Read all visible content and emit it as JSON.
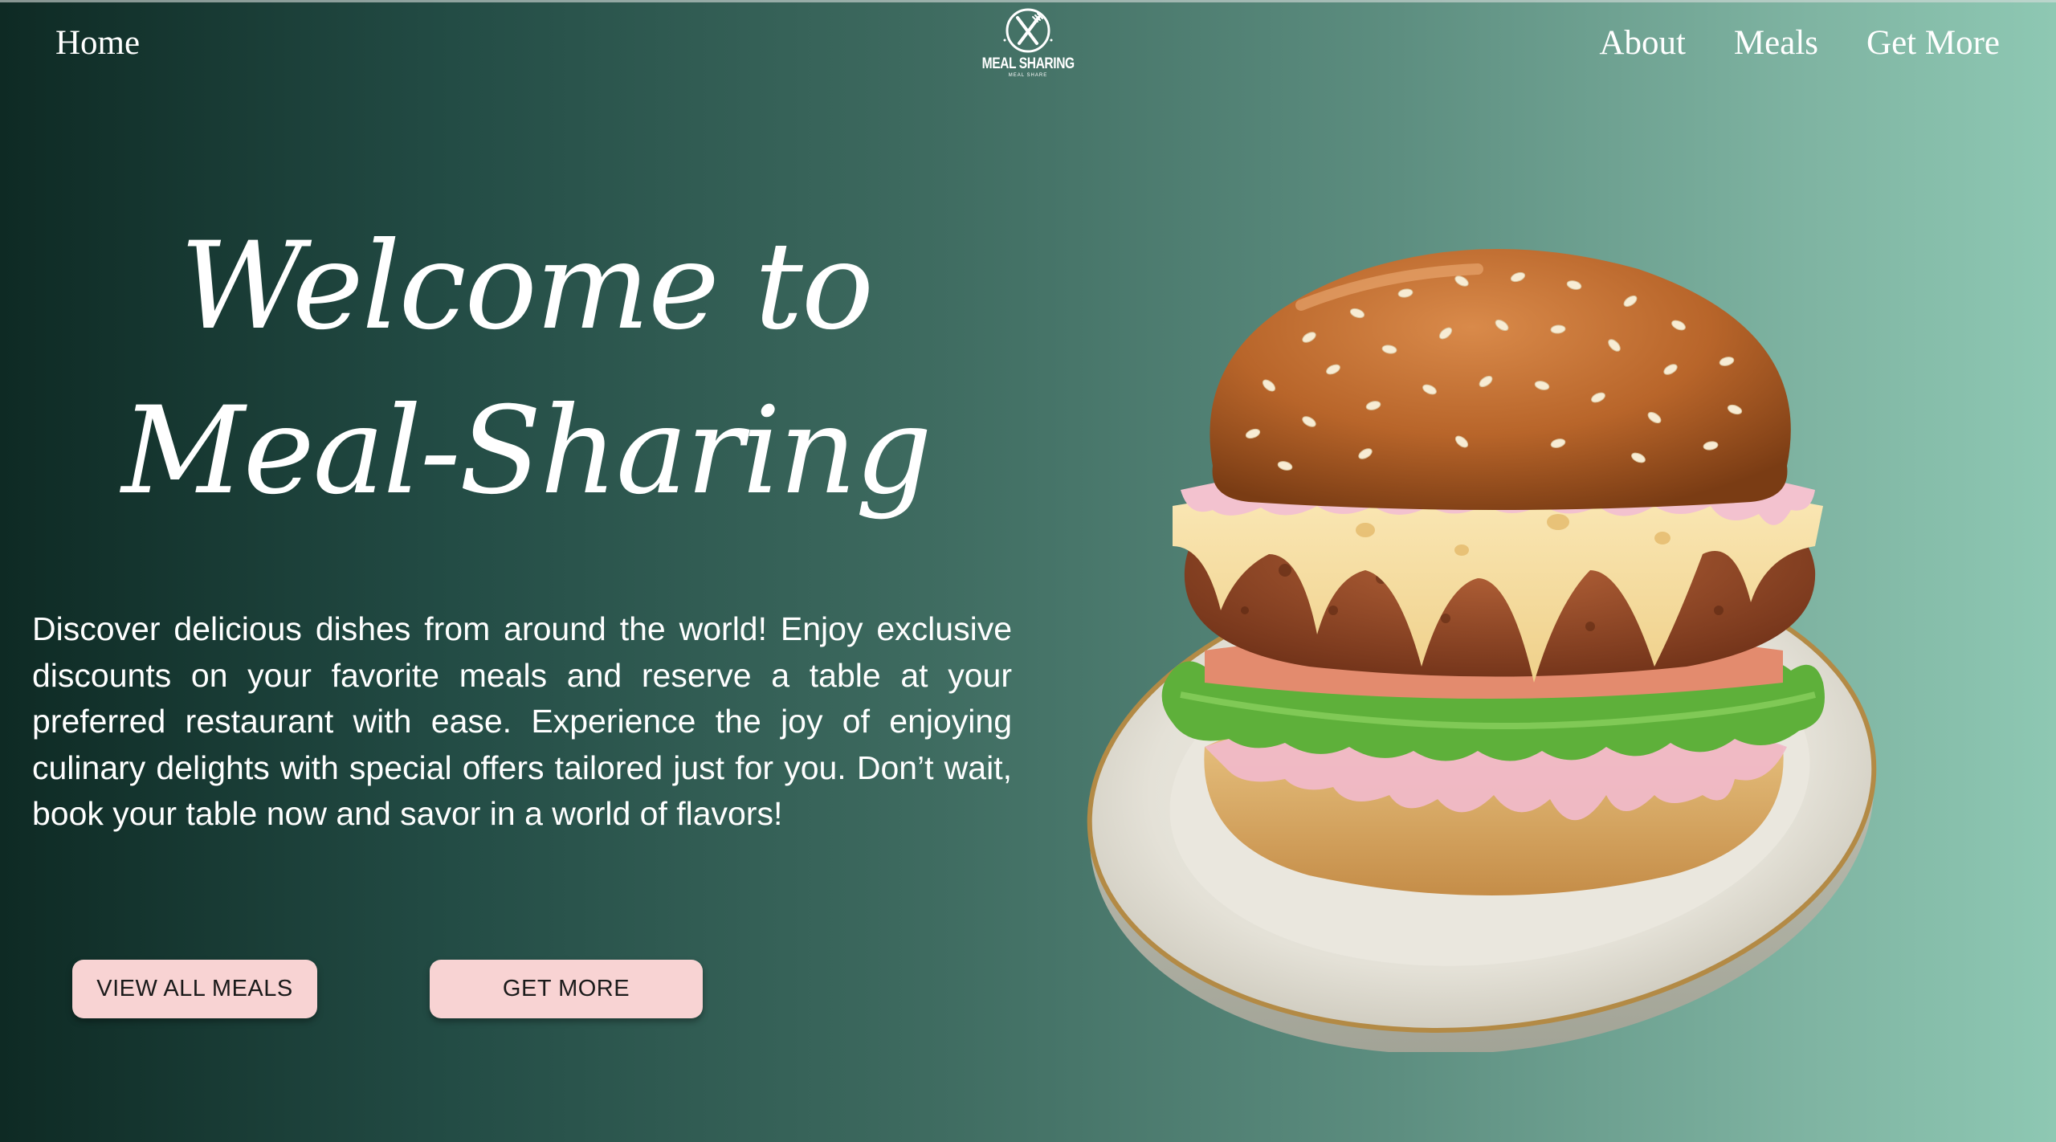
{
  "nav": {
    "home_label": "Home",
    "links": [
      "About",
      "Meals",
      "Get More"
    ]
  },
  "logo": {
    "title": "MEAL SHARING",
    "subtitle": "MEAL SHARE",
    "icon": "fork-knife-circle-icon"
  },
  "hero": {
    "title": "Welcome to Meal-Sharing",
    "description": "Discover delicious dishes from around the world! Enjoy exclusive discounts on your favorite meals and reserve a table at your preferred restaurant with ease. Experience the joy of enjoying culinary delights with special offers tailored just for you. Don’t wait, book your table now and savor in a world of flavors!",
    "buttons": {
      "view_all_meals": "VIEW ALL MEALS",
      "get_more": "GET MORE"
    },
    "image": "burger-on-plate-image"
  },
  "colors": {
    "gradient_start": "#0e2a24",
    "gradient_end": "#8ec8b3",
    "button_bg": "#f8d3d3",
    "text": "#ffffff"
  }
}
